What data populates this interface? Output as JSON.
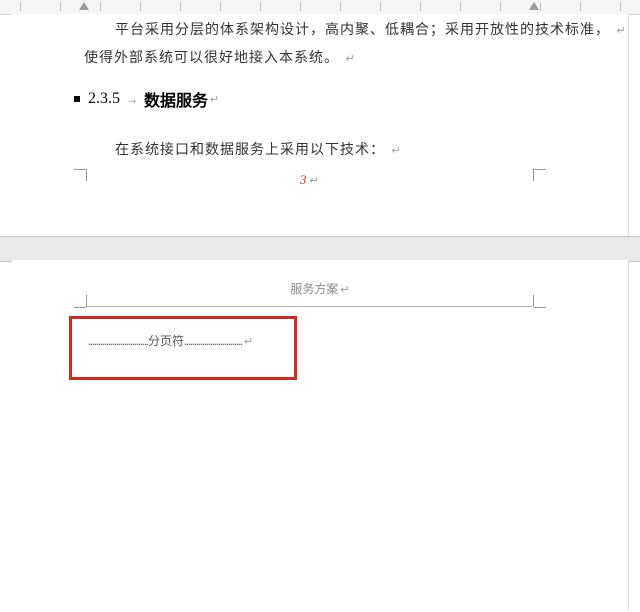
{
  "page1": {
    "para_line1": "平台采用分层的体系架构设计，高内聚、低耦合；采用开放性的技术标准，",
    "para_line2": "使得外部系统可以很好地接入本系统。",
    "heading_number": "2.3.5",
    "heading_text": "数据服务",
    "para_line3": "在系统接口和数据服务上采用以下技术：",
    "page_number": "3"
  },
  "page2": {
    "header_text": "服务方案",
    "page_break_label": "分页符"
  },
  "marks": {
    "return": "↵",
    "tab_arrow": "→"
  }
}
